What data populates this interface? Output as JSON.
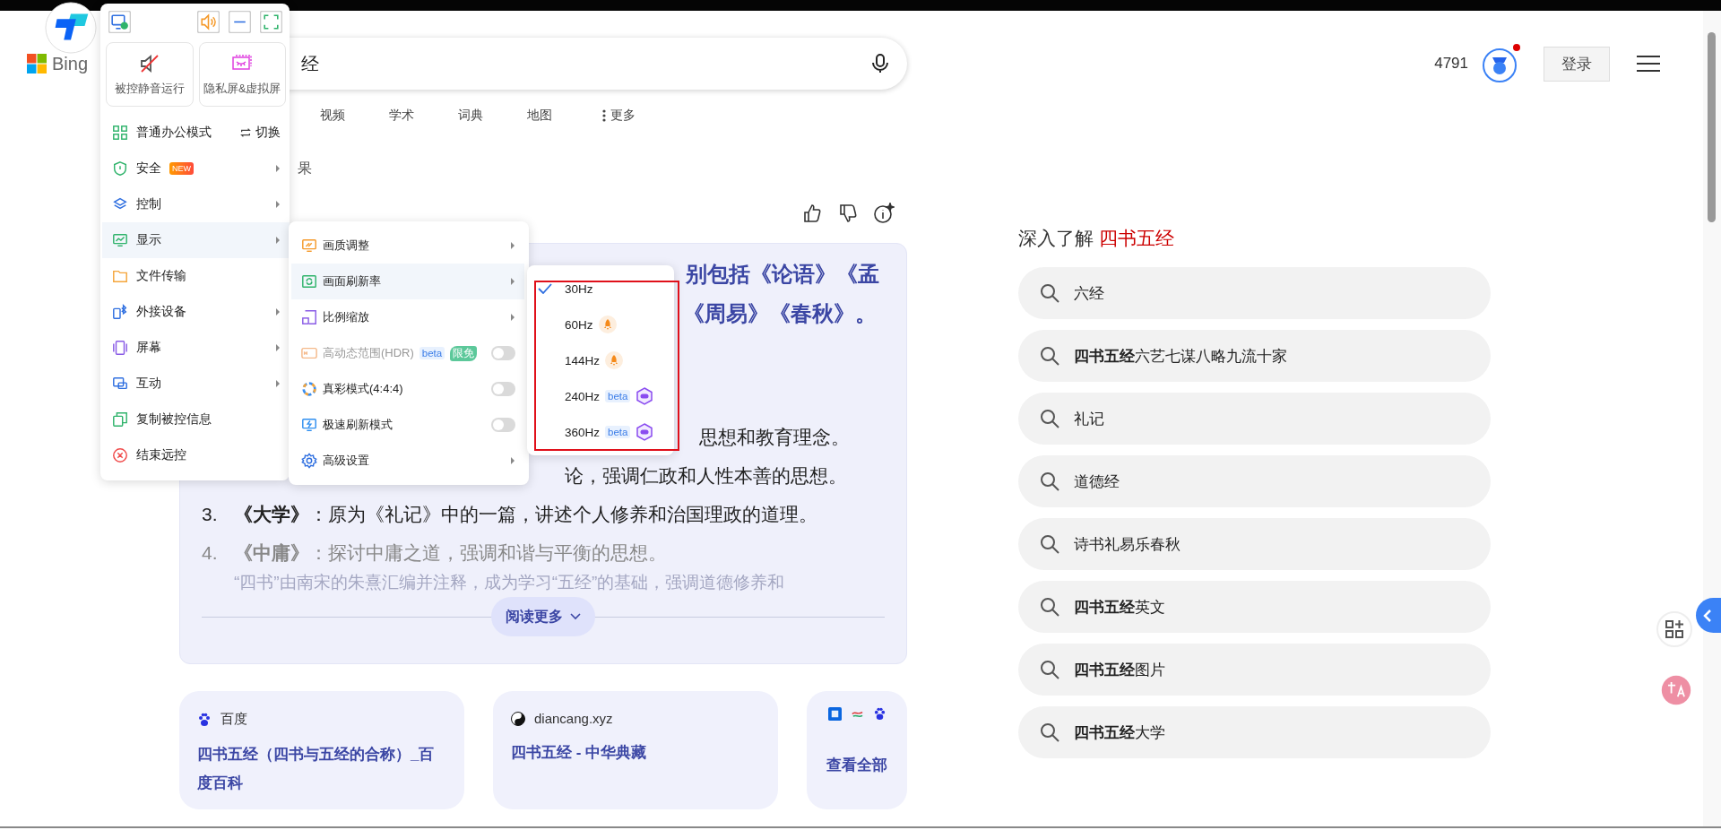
{
  "header": {
    "logo": "Bing",
    "search": {
      "value": "经"
    },
    "points": "4791",
    "login": "登录"
  },
  "nav_tabs": [
    "视频",
    "学术",
    "词典",
    "地图",
    "更多"
  ],
  "result_fragment": "果",
  "answer": {
    "heading_lines": [
      "别包括《论语》《孟",
      "《周易》《春秋》。"
    ],
    "list": [
      {
        "text": "思想和教育理念。",
        "faded": false
      },
      {
        "text": "论，强调仁政和人性本善的思想。",
        "faded": false
      },
      {
        "number": "3.",
        "text": "**《大学》**：原为《礼记》中的一篇，讲述个人修养和治国理政的道理。",
        "faded": false
      },
      {
        "number": "4.",
        "text": "**《中庸》**：探讨中庸之道，强调和谐与平衡的思想。",
        "faded": true
      }
    ],
    "summary_fragment": "“四书”由南宋的朱熹汇编并注释，成为学习“五经”的基础，强调道德修养和",
    "read_more": "阅读更多"
  },
  "sources": [
    {
      "site": "百度",
      "title": "四书五经（四书与五经的合称）_百度百科"
    },
    {
      "site": "diancang.xyz",
      "title": "四书五经 - 中华典藏"
    }
  ],
  "more_sources": "查看全部",
  "related": {
    "heading": "深入了解",
    "query": "四书五经",
    "items": [
      "六经",
      "**四书五经**六艺七谋八略九流十家",
      "礼记",
      "道德经",
      "诗书礼易乐春秋",
      "**四书五经**英文",
      "**四书五经**图片",
      "**四书五经**大学"
    ]
  },
  "remote_menu": {
    "tiles": [
      {
        "label": "被控静音运行"
      },
      {
        "label": "隐私屏&虚拟屏"
      }
    ],
    "items": [
      {
        "label": "普通办公模式",
        "action": "切换",
        "submenu": false,
        "selected": false
      },
      {
        "label": "安全",
        "badge": "NEW",
        "submenu": true,
        "selected": false
      },
      {
        "label": "控制",
        "submenu": true,
        "selected": false
      },
      {
        "label": "显示",
        "submenu": true,
        "selected": true
      },
      {
        "label": "文件传输",
        "submenu": false,
        "selected": false
      },
      {
        "label": "外接设备",
        "submenu": true,
        "selected": false
      },
      {
        "label": "屏幕",
        "submenu": true,
        "selected": false
      },
      {
        "label": "互动",
        "submenu": true,
        "selected": false
      },
      {
        "label": "复制被控信息",
        "submenu": false,
        "selected": false
      },
      {
        "label": "结束远控",
        "submenu": false,
        "selected": false
      }
    ]
  },
  "display_menu": {
    "items": [
      {
        "label": "画质调整",
        "kind": "submenu",
        "selected": false,
        "disabled": false
      },
      {
        "label": "画面刷新率",
        "kind": "submenu",
        "selected": true,
        "disabled": false
      },
      {
        "label": "比例缩放",
        "kind": "submenu",
        "selected": false,
        "disabled": false
      },
      {
        "label": "高动态范围(HDR)",
        "kind": "toggle",
        "on": false,
        "selected": false,
        "disabled": true,
        "badges": [
          {
            "text": "beta",
            "kind": "beta"
          },
          {
            "text": "限免",
            "kind": "free"
          }
        ]
      },
      {
        "label": "真彩模式(4:4:4)",
        "kind": "toggle",
        "on": false,
        "selected": false,
        "disabled": false
      },
      {
        "label": "极速刷新模式",
        "kind": "toggle",
        "on": false,
        "selected": false,
        "disabled": false
      },
      {
        "label": "高级设置",
        "kind": "submenu",
        "selected": false,
        "disabled": false
      }
    ]
  },
  "refresh_menu": {
    "items": [
      {
        "label": "30Hz",
        "kind": "plain",
        "selected": true
      },
      {
        "label": "60Hz",
        "kind": "boost",
        "selected": false
      },
      {
        "label": "144Hz",
        "kind": "boost",
        "selected": false
      },
      {
        "label": "240Hz",
        "kind": "game",
        "badge": "beta",
        "selected": false
      },
      {
        "label": "360Hz",
        "kind": "game",
        "badge": "beta",
        "selected": false
      }
    ]
  }
}
